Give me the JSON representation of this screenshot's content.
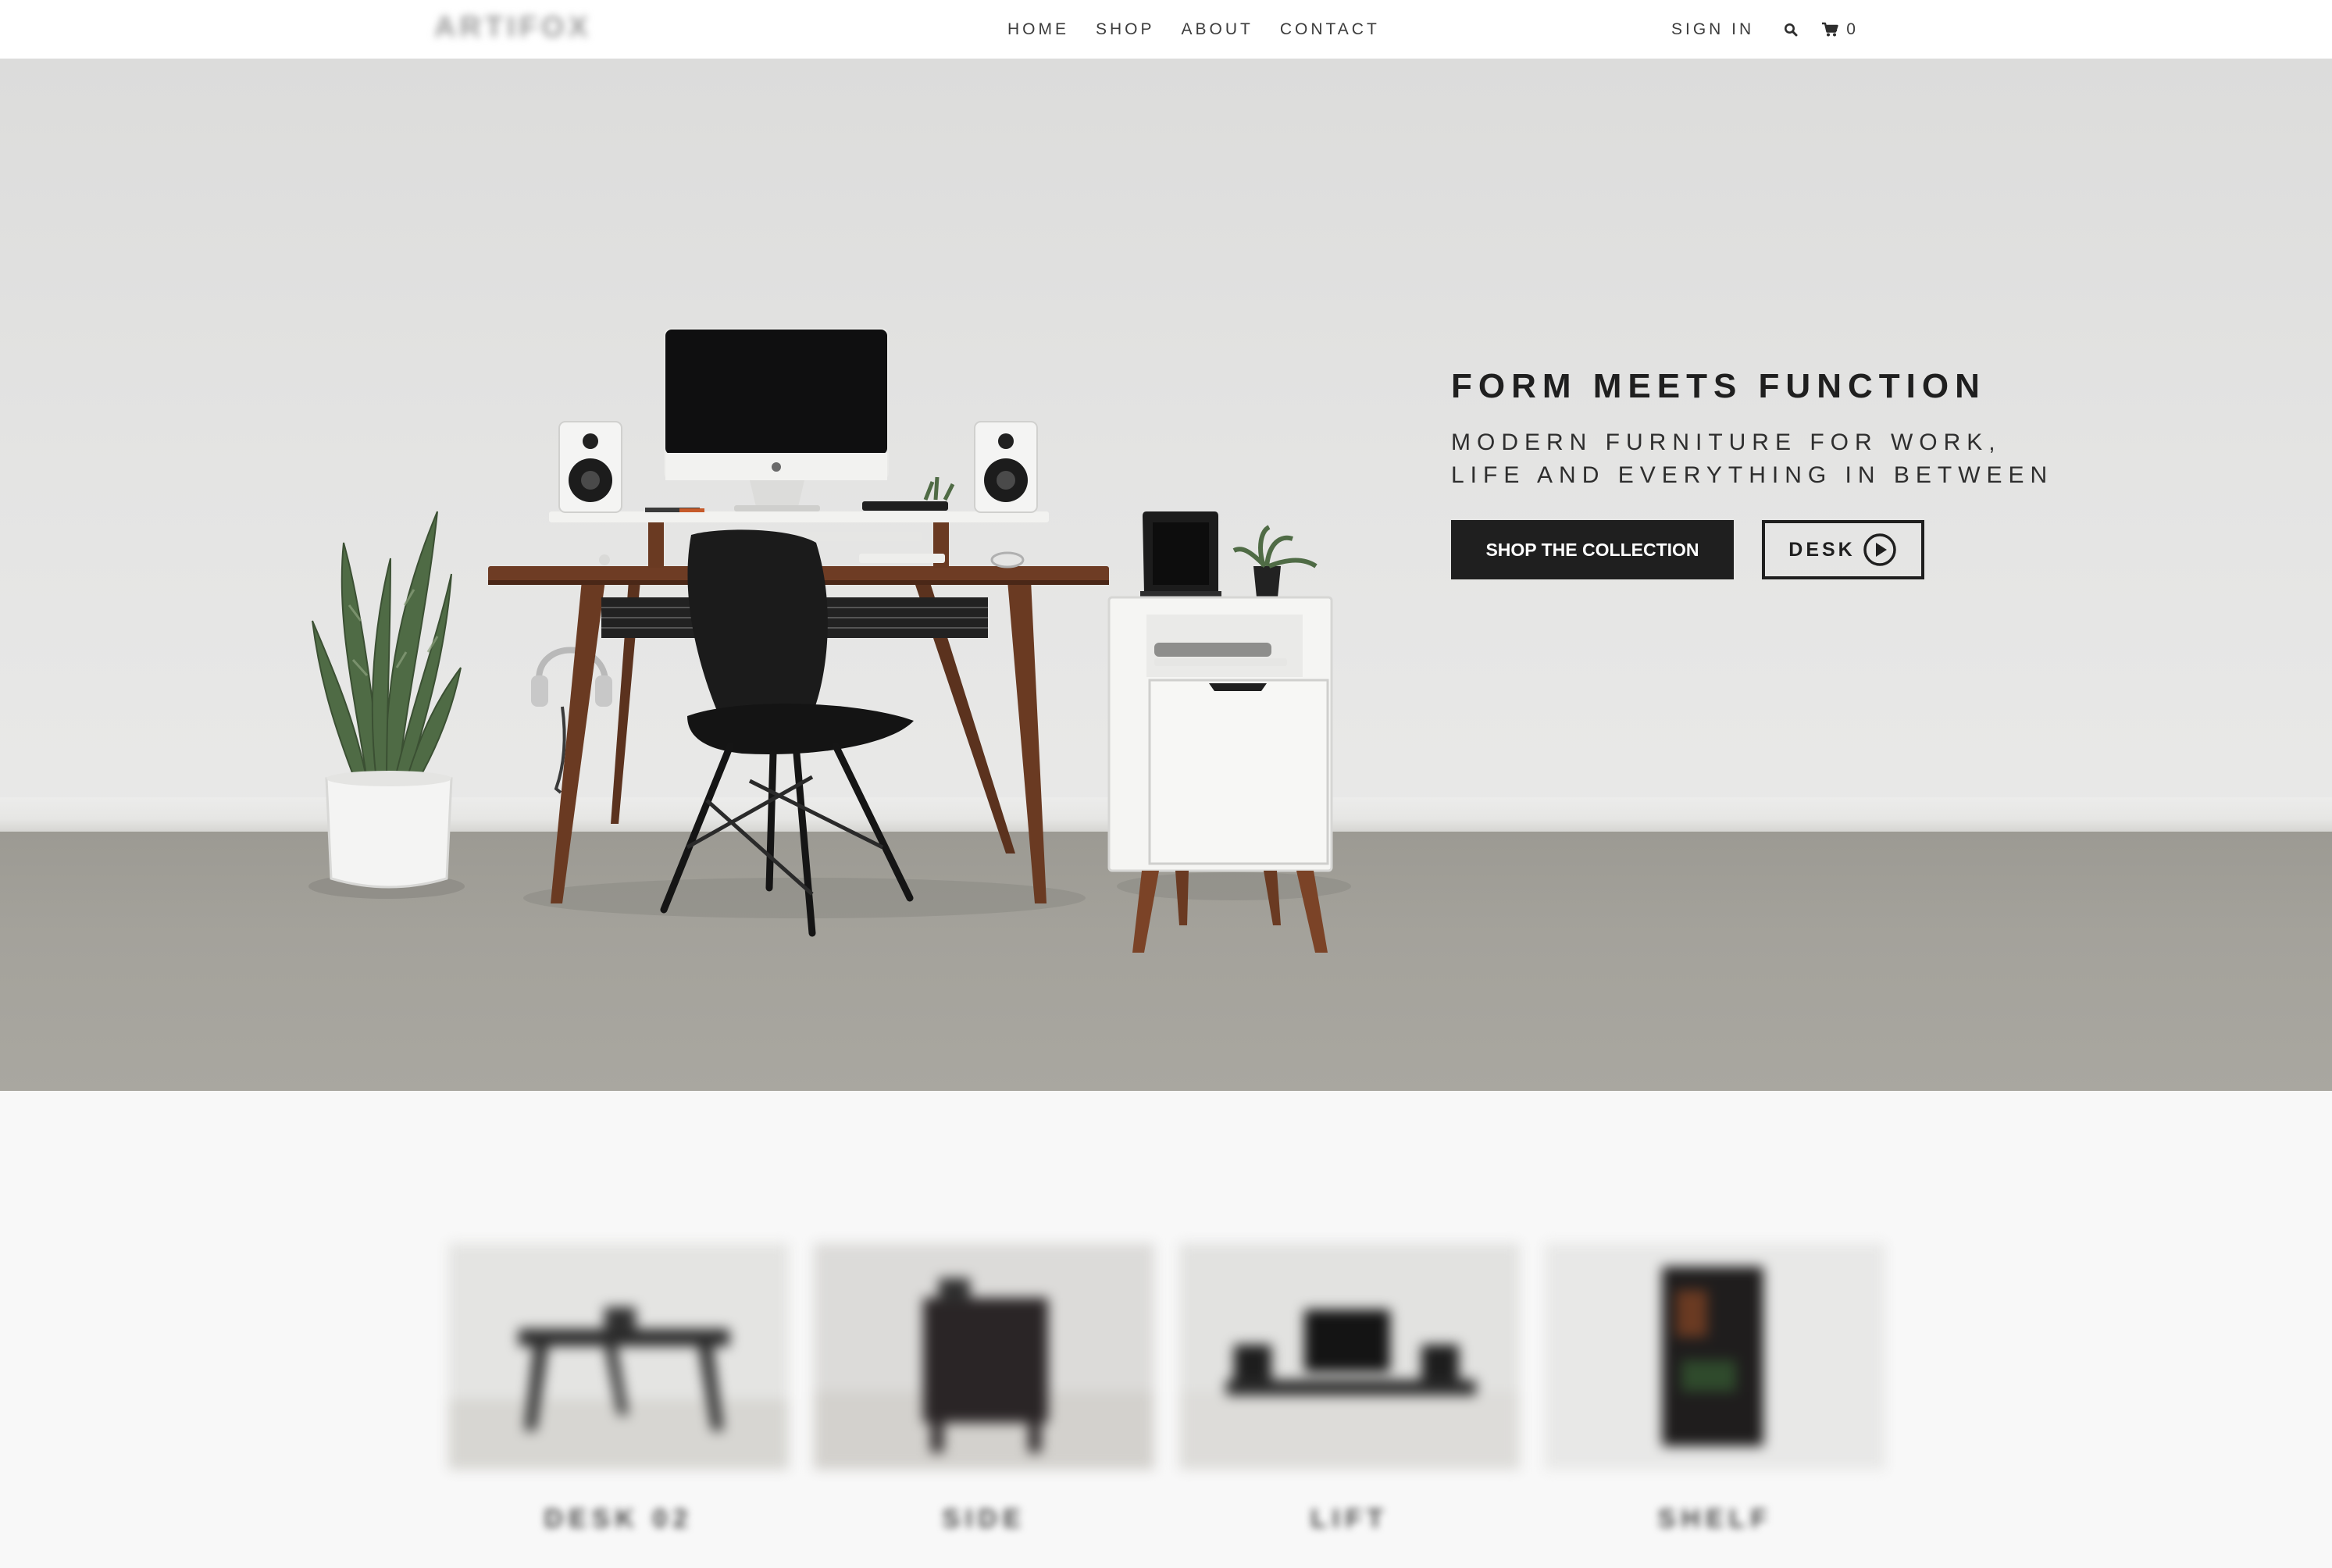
{
  "brand": {
    "logo_text": "ARTIFOX"
  },
  "nav": {
    "links": [
      "HOME",
      "SHOP",
      "ABOUT",
      "CONTACT"
    ],
    "sign_in": "SIGN IN",
    "cart_count": "0"
  },
  "hero": {
    "title": "FORM MEETS FUNCTION",
    "subtitle": "MODERN FURNITURE FOR WORK, LIFE AND EVERYTHING IN BETWEEN",
    "primary_button": "SHOP THE COLLECTION",
    "secondary_button": "DESK"
  },
  "products": [
    {
      "name": "DESK 02"
    },
    {
      "name": "SIDE"
    },
    {
      "name": "LIFT"
    },
    {
      "name": "SHELF"
    }
  ],
  "colors": {
    "accent_dark": "#1f1f1f",
    "wall": "#e6e6e5",
    "floor": "#a4a29b",
    "page_background": "#f8f8f8"
  },
  "icons": [
    "search-icon",
    "cart-icon",
    "play-icon"
  ]
}
